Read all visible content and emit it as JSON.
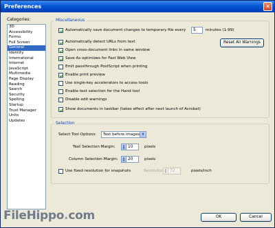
{
  "window": {
    "title": "Preferences",
    "close_glyph": "✕"
  },
  "categories": {
    "label": "Categories:",
    "items": [
      "3D",
      "Accessibility",
      "Forms",
      "Full Screen",
      "General",
      "Identity",
      "International",
      "Internet",
      "JavaScript",
      "Multimedia",
      "Page Display",
      "Reading",
      "Search",
      "Security",
      "Spelling",
      "Startup",
      "Trust Manager",
      "Units",
      "Updates"
    ],
    "selected": "General"
  },
  "misc": {
    "title": "Miscellaneous",
    "autosave": {
      "label": "Automatically save document changes to temporary file every",
      "checked": true,
      "value": "5",
      "unit": "minutes (1-99)"
    },
    "detect_urls": {
      "label": "Automatically detect URLs from text",
      "checked": true
    },
    "reset_warnings": "Reset All Warnings",
    "open_cross_links": {
      "label": "Open cross-document links in same window",
      "checked": true
    },
    "save_as_optimizes": {
      "label": "Save As optimizes for Fast Web View",
      "checked": true
    },
    "emit_passthrough": {
      "label": "Emit passthrough PostScript when printing",
      "checked": false
    },
    "print_preview": {
      "label": "Enable print preview",
      "checked": true
    },
    "single_key": {
      "label": "Use single-key accelerators to access tools",
      "checked": false
    },
    "text_selection_hand": {
      "label": "Enable text selection for the Hand tool",
      "checked": false
    },
    "disable_edit_warnings": {
      "label": "Disable edit warnings",
      "checked": false
    },
    "show_taskbar": {
      "label": "Show documents in taskbar (takes effect after next launch of Acrobat)",
      "checked": true
    }
  },
  "selection": {
    "title": "Selection",
    "tool_options_label": "Select Tool Options:",
    "tool_options_value": "Text before images",
    "text_margin_label": "Text Selection Margin:",
    "text_margin_value": "10",
    "column_margin_label": "Column Selection Margin:",
    "column_margin_value": "20",
    "pixels": "pixels",
    "fixed_resolution": {
      "label": "Use fixed resolution for snapshots",
      "checked": false
    },
    "resolution_label": "Resolution:",
    "resolution_value": "72",
    "resolution_unit": "pixels/inch"
  },
  "buttons": {
    "ok": "OK",
    "cancel": "Cancel"
  },
  "watermark": {
    "brand": "FileHippo",
    "dot": ".",
    "tld": "com"
  },
  "colors": {
    "selected_bg": "#316ac5",
    "group_title": "#0046d5",
    "title_bar": "#0b5bd8"
  }
}
